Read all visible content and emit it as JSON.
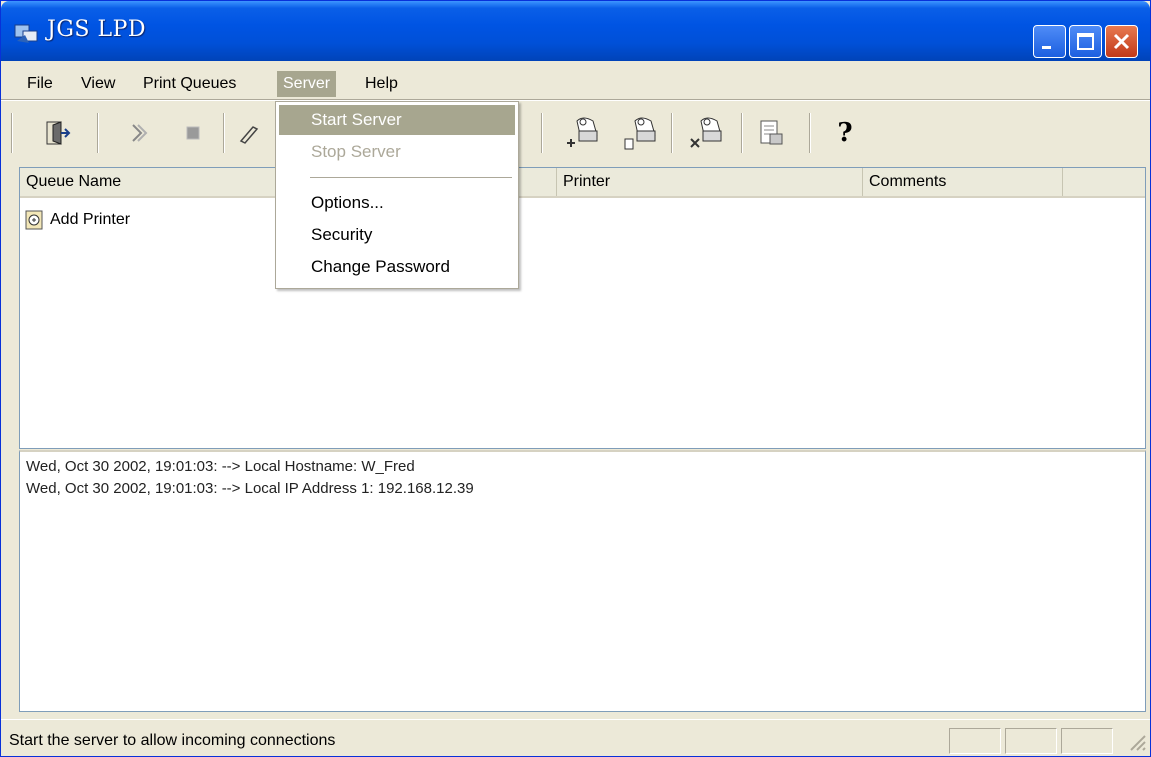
{
  "window": {
    "title": "JGS LPD"
  },
  "menubar": {
    "items": [
      {
        "label": "File"
      },
      {
        "label": "View"
      },
      {
        "label": "Print Queues"
      },
      {
        "label": "Server"
      },
      {
        "label": "Help"
      }
    ],
    "active": "Server"
  },
  "server_menu": {
    "items": [
      {
        "label": "Start Server",
        "state": "highlighted"
      },
      {
        "label": "Stop Server",
        "state": "disabled"
      },
      {
        "label": "Options..."
      },
      {
        "label": "Security"
      },
      {
        "label": "Change Password"
      }
    ]
  },
  "toolbar": {
    "icons": [
      "exit-icon",
      "start-icon",
      "stop-icon",
      "edit-icon",
      "add-printer-icon",
      "printer-properties-icon",
      "delete-printer-icon",
      "queue-icon",
      "help-icon"
    ],
    "help_glyph": "?"
  },
  "list": {
    "columns": [
      {
        "label": "Queue Name"
      },
      {
        "label": "Printer"
      },
      {
        "label": "Comments"
      }
    ],
    "rows": [
      {
        "name": "Add Printer",
        "icon": "add-printer-icon"
      }
    ]
  },
  "log": {
    "lines": [
      "Wed, Oct 30 2002, 19:01:03: --> Local Hostname: W_Fred",
      "Wed, Oct 30 2002, 19:01:03: --> Local IP Address 1: 192.168.12.39"
    ]
  },
  "statusbar": {
    "text": "Start the server to allow incoming connections"
  },
  "colors": {
    "titlebar": "#0054e3",
    "menu_highlight": "#a7a68f",
    "chrome": "#ece9d8"
  }
}
